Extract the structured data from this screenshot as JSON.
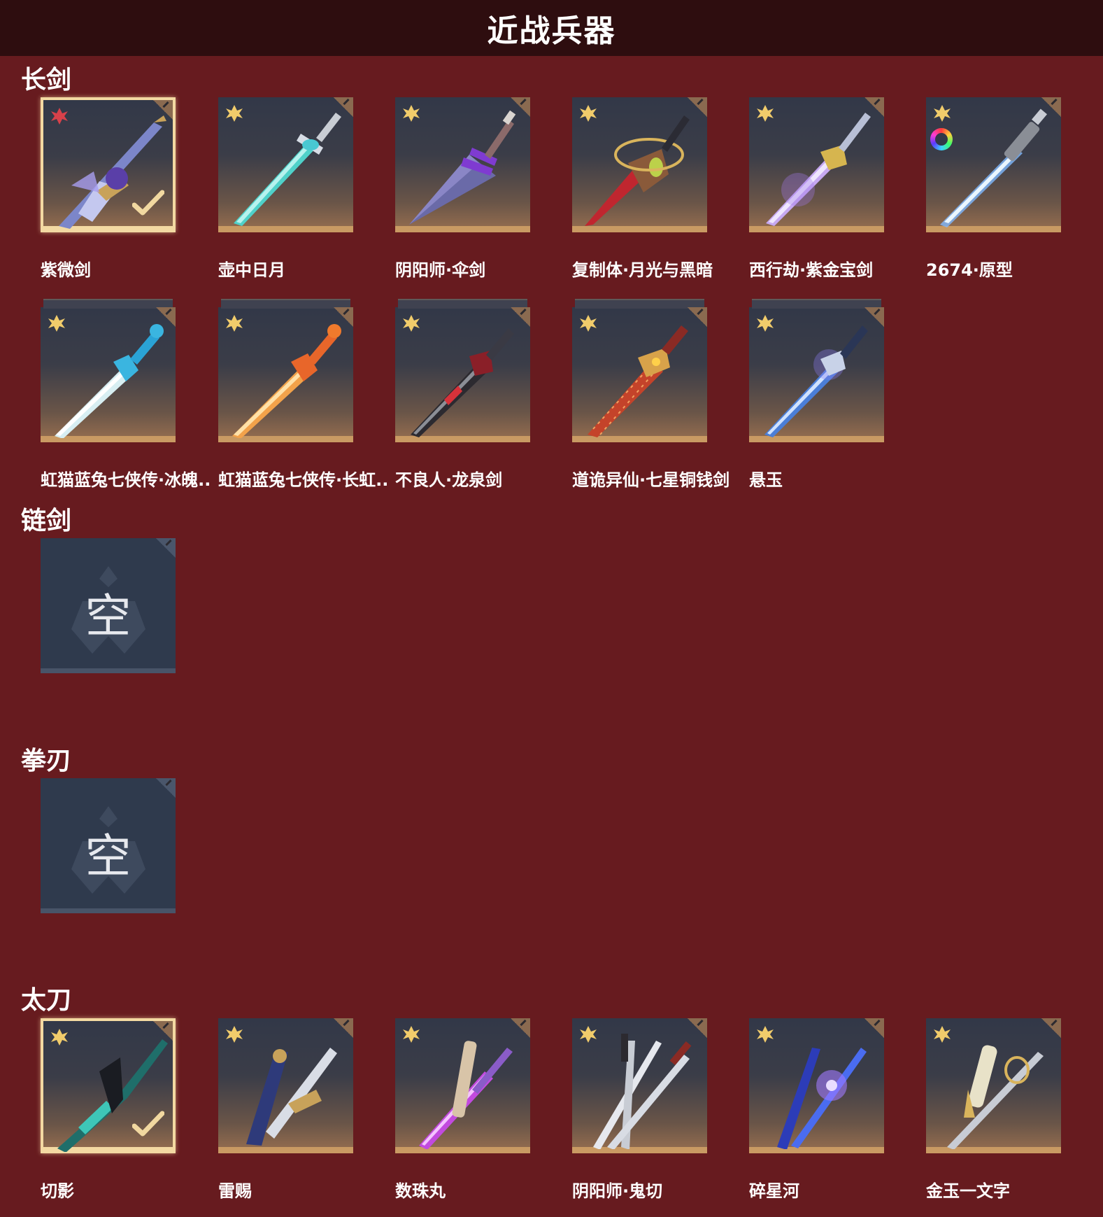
{
  "header": {
    "title": "近战兵器"
  },
  "sections": {
    "longsword": "长剑",
    "chainsword": "链剑",
    "fistblade": "拳刃",
    "katana": "太刀"
  },
  "longsword_items": [
    "紫微剑",
    "壶中日月",
    "阴阳师·伞剑",
    "复制体·月光与黑暗",
    "西行劫·紫金宝剑",
    "2674·原型",
    "虹猫蓝兔七侠传·冰魄..",
    "虹猫蓝兔七侠传·长虹..",
    "不良人·龙泉剑",
    "道诡异仙·七星铜钱剑",
    "悬玉"
  ],
  "empty_label": "空",
  "katana_items": [
    "切影",
    "雷赐",
    "数珠丸",
    "阴阳师·鬼切",
    "碎星河",
    "金玉一文字"
  ],
  "colors": {
    "background": "#671b1f",
    "header_bg": "#2e0d0f",
    "card_border": "#c99a63",
    "selected_border": "#f3d9a2"
  },
  "icons": [
    "gold-flower-rarity-icon",
    "red-flower-rarity-icon",
    "checkmark-icon",
    "color-ring-icon",
    "corner-tag-icon"
  ]
}
